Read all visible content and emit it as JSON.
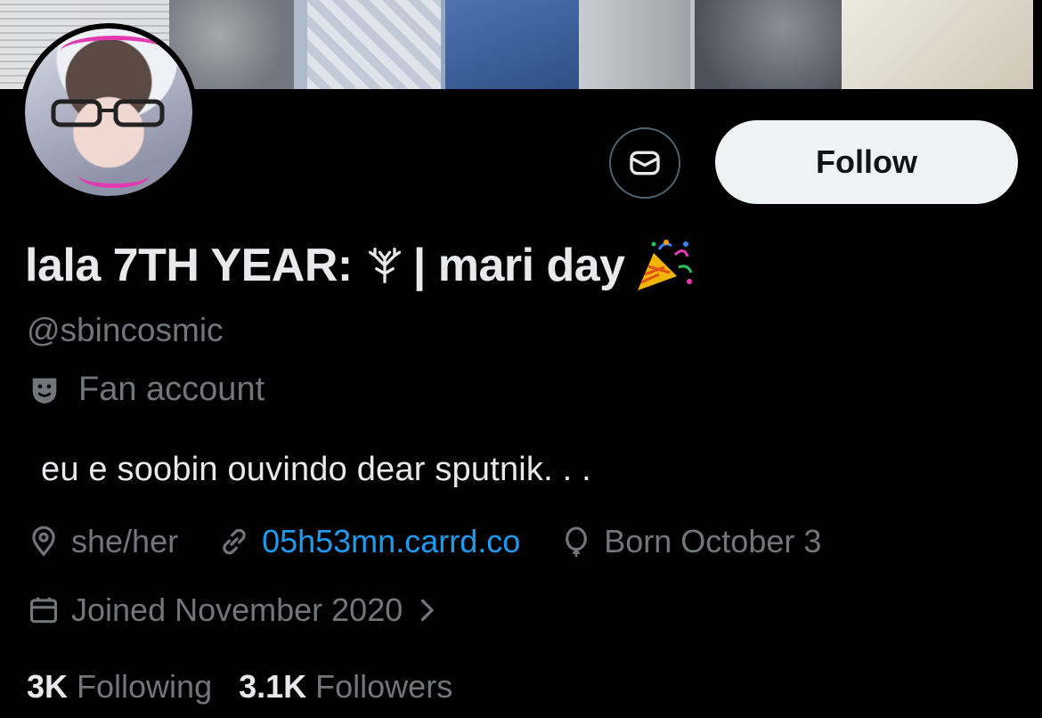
{
  "header": {
    "banner_alt": "",
    "message_icon": "envelope-icon",
    "follow_label": "Follow"
  },
  "profile": {
    "display_name": "lala 7TH YEAR: ⚲ | mari day",
    "display_name_text": "lala 7TH YEAR:",
    "display_name_symbol": "⛦",
    "display_name_rest": "| mari day",
    "handle": "@sbincosmic",
    "category_icon": "theater-mask-icon",
    "category": "Fan account",
    "bio": "eu e soobin ouvindo dear sputnik. . .",
    "location_icon": "location-pin-icon",
    "location": "she/her",
    "link_icon": "link-icon",
    "link": "05h53mn.carrd.co",
    "birthday_icon": "balloon-icon",
    "birthday": "Born October 3",
    "joined_icon": "calendar-icon",
    "joined": "Joined November 2020",
    "joined_chevron": "chevron-right-icon"
  },
  "stats": {
    "following_count": "3K",
    "following_label": "Following",
    "followers_count": "3.1K",
    "followers_label": "Followers"
  },
  "colors": {
    "background": "#000000",
    "primary_text": "#e7e9ea",
    "secondary_text": "#71767b",
    "link": "#1d9bf0",
    "follow_button_bg": "#eff3f4"
  }
}
